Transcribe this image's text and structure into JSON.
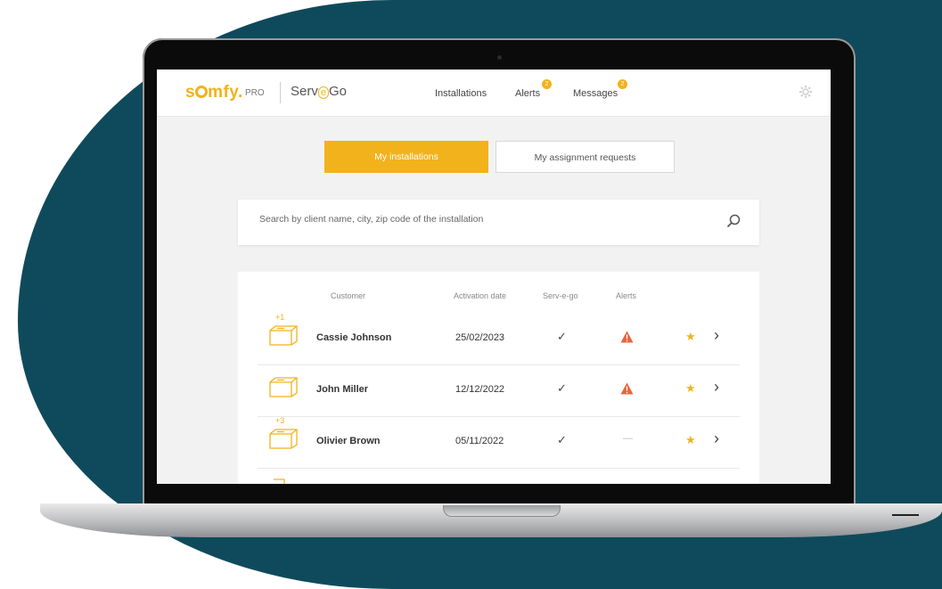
{
  "nav": {
    "logo": "somfy",
    "logo_suffix": "PRO",
    "app_name_prefix": "Serv",
    "app_name_mid": "e",
    "app_name_suffix": "Go",
    "links": [
      {
        "label": "Installations"
      },
      {
        "label": "Alerts",
        "badge": "2"
      },
      {
        "label": "Messages",
        "badge": "2"
      }
    ],
    "settings_icon": "gear-icon"
  },
  "tabs": [
    {
      "label": "My installations",
      "active": true
    },
    {
      "label": "My assignment requests",
      "active": false
    }
  ],
  "search": {
    "placeholder": "Search by client name, city, zip code of the installation",
    "icon": "search-icon"
  },
  "table": {
    "headers": [
      "Customer",
      "Activation date",
      "Serv-e-go",
      "Alerts"
    ],
    "rows": [
      {
        "extra": "+1",
        "customer": "Cassie Johnson",
        "date": "25/02/2023",
        "serv_e_go": "✓",
        "alert": "warning"
      },
      {
        "extra": "",
        "customer": "John Miller",
        "date": "12/12/2022",
        "serv_e_go": "✓",
        "alert": "warning"
      },
      {
        "extra": "+3",
        "customer": "Olivier Brown",
        "date": "05/11/2022",
        "serv_e_go": "✓",
        "alert": "—"
      }
    ]
  },
  "colors": {
    "accent": "#f2b21b",
    "alert": "#e8643a",
    "background": "#0f4a5c"
  }
}
